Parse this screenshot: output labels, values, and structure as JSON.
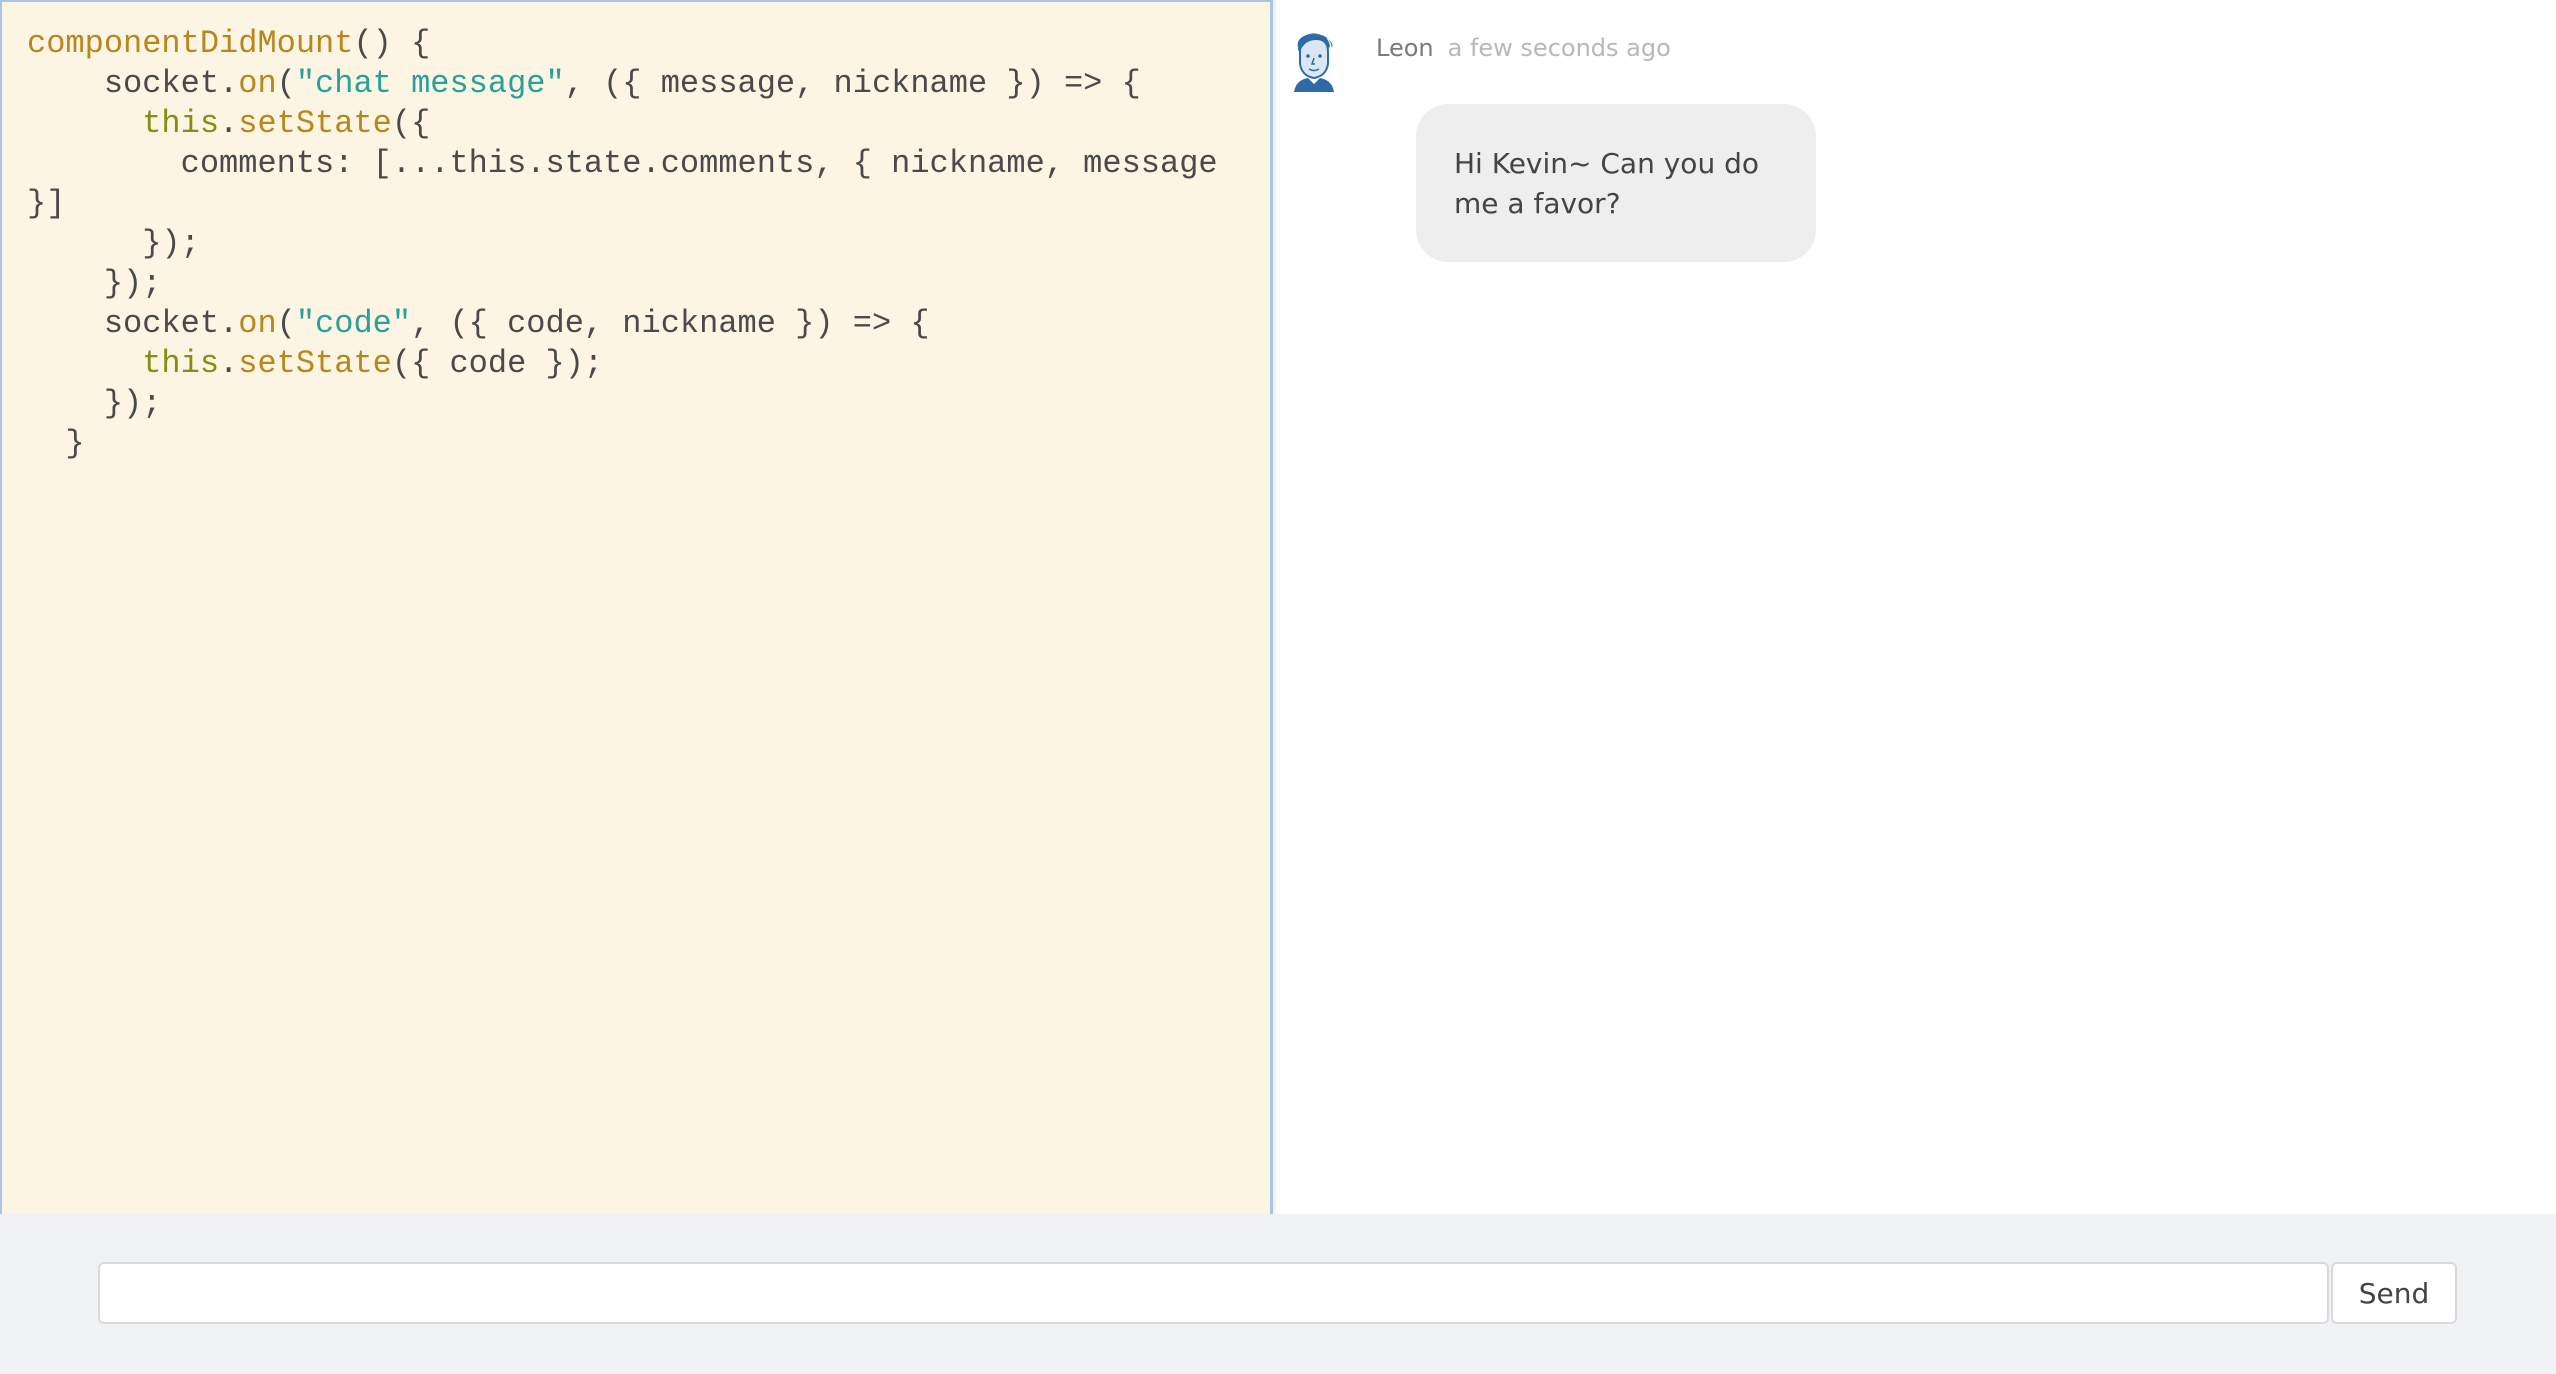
{
  "editor": {
    "lines": [
      [
        {
          "t": "componentDidMount",
          "c": "fn"
        },
        {
          "t": "() {",
          "c": "txt"
        }
      ],
      [
        {
          "t": "    socket.",
          "c": "txt"
        },
        {
          "t": "on",
          "c": "fn"
        },
        {
          "t": "(",
          "c": "txt"
        },
        {
          "t": "\"chat message\"",
          "c": "str"
        },
        {
          "t": ", ({ message, nickname }) => {",
          "c": "txt"
        }
      ],
      [
        {
          "t": "      ",
          "c": "txt"
        },
        {
          "t": "this",
          "c": "kw"
        },
        {
          "t": ".",
          "c": "txt"
        },
        {
          "t": "setState",
          "c": "fn"
        },
        {
          "t": "({",
          "c": "txt"
        }
      ],
      [
        {
          "t": "        comments: [...this.state.comments, { nickname, message",
          "c": "txt"
        }
      ],
      [
        {
          "t": "}]",
          "c": "txt"
        }
      ],
      [
        {
          "t": "      });",
          "c": "txt"
        }
      ],
      [
        {
          "t": "    });",
          "c": "txt"
        }
      ],
      [
        {
          "t": "    socket.",
          "c": "txt"
        },
        {
          "t": "on",
          "c": "fn"
        },
        {
          "t": "(",
          "c": "txt"
        },
        {
          "t": "\"code\"",
          "c": "str"
        },
        {
          "t": ", ({ code, nickname }) => {",
          "c": "txt"
        }
      ],
      [
        {
          "t": "      ",
          "c": "txt"
        },
        {
          "t": "this",
          "c": "kw"
        },
        {
          "t": ".",
          "c": "txt"
        },
        {
          "t": "setState",
          "c": "fn"
        },
        {
          "t": "({ code });",
          "c": "txt"
        }
      ],
      [
        {
          "t": "    });",
          "c": "txt"
        }
      ],
      [
        {
          "t": "  }",
          "c": "txt"
        }
      ]
    ],
    "colors": {
      "background": "#fdf5e4",
      "function": "#b8861b",
      "keyword": "#8a8a14",
      "string": "#2aa198",
      "text": "#4a4a4a"
    }
  },
  "chat": {
    "messages": [
      {
        "author": "Leon",
        "time": "a few seconds ago",
        "text": "Hi Kevin~ Can you do me a favor?",
        "avatar_icon": "user-avatar-icon"
      }
    ]
  },
  "input": {
    "value": "",
    "placeholder": ""
  },
  "send_label": "Send"
}
